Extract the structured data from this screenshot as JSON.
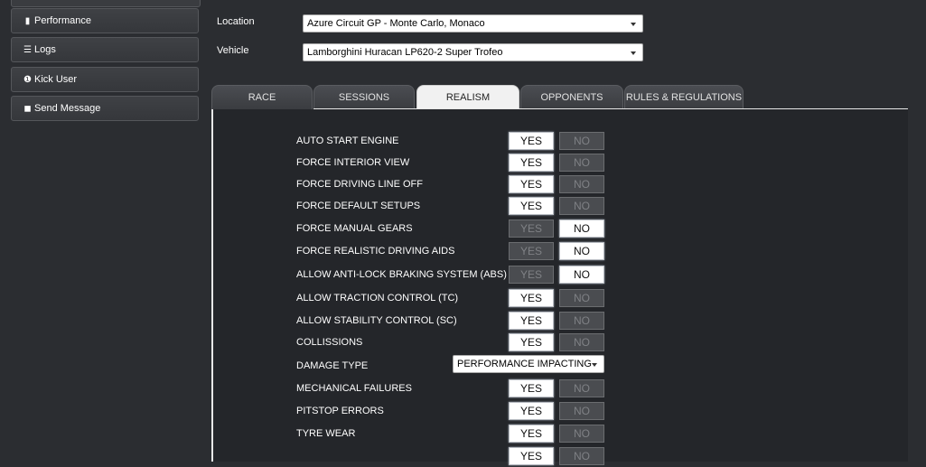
{
  "sidebar": {
    "items": [
      {
        "label": "Performance",
        "icon": "bar-chart-icon",
        "glyph": "▮"
      },
      {
        "label": "Logs",
        "icon": "list-icon",
        "glyph": "☰"
      },
      {
        "label": "Kick User",
        "icon": "info-circle-icon",
        "glyph": "❶"
      },
      {
        "label": "Send Message",
        "icon": "message-icon",
        "glyph": "◼"
      }
    ]
  },
  "form": {
    "location_label": "Location",
    "location_value": "Azure Circuit GP - Monte Carlo, Monaco",
    "vehicle_label": "Vehicle",
    "vehicle_value": "Lamborghini Huracan LP620-2 Super Trofeo"
  },
  "tabs": [
    {
      "label": "RACE",
      "active": false
    },
    {
      "label": "SESSIONS",
      "active": false
    },
    {
      "label": "REALISM",
      "active": true
    },
    {
      "label": "OPPONENTS",
      "active": false
    },
    {
      "label": "RULES & REGULATIONS",
      "active": false
    }
  ],
  "toggle_labels": {
    "yes": "YES",
    "no": "NO"
  },
  "realism": {
    "rows": [
      {
        "label": "AUTO START ENGINE",
        "value": "YES"
      },
      {
        "label": "FORCE INTERIOR VIEW",
        "value": "YES"
      },
      {
        "label": "FORCE DRIVING LINE OFF",
        "value": "YES"
      },
      {
        "label": "FORCE DEFAULT SETUPS",
        "value": "YES"
      },
      {
        "label": "FORCE MANUAL GEARS",
        "value": "NO"
      },
      {
        "label": "FORCE REALISTIC DRIVING AIDS",
        "value": "NO"
      },
      {
        "label": "ALLOW ANTI-LOCK BRAKING SYSTEM (ABS)",
        "value": "NO"
      },
      {
        "label": "ALLOW TRACTION CONTROL (TC)",
        "value": "YES"
      },
      {
        "label": "ALLOW STABILITY CONTROL (SC)",
        "value": "YES"
      },
      {
        "label": "COLLISSIONS",
        "value": "YES"
      },
      {
        "label": "DAMAGE TYPE",
        "select": "PERFORMANCE IMPACTING"
      },
      {
        "label": "MECHANICAL FAILURES",
        "value": "YES"
      },
      {
        "label": "PITSTOP ERRORS",
        "value": "YES"
      },
      {
        "label": "TYRE WEAR",
        "value": "YES"
      },
      {
        "label": "",
        "value": "YES"
      }
    ]
  }
}
